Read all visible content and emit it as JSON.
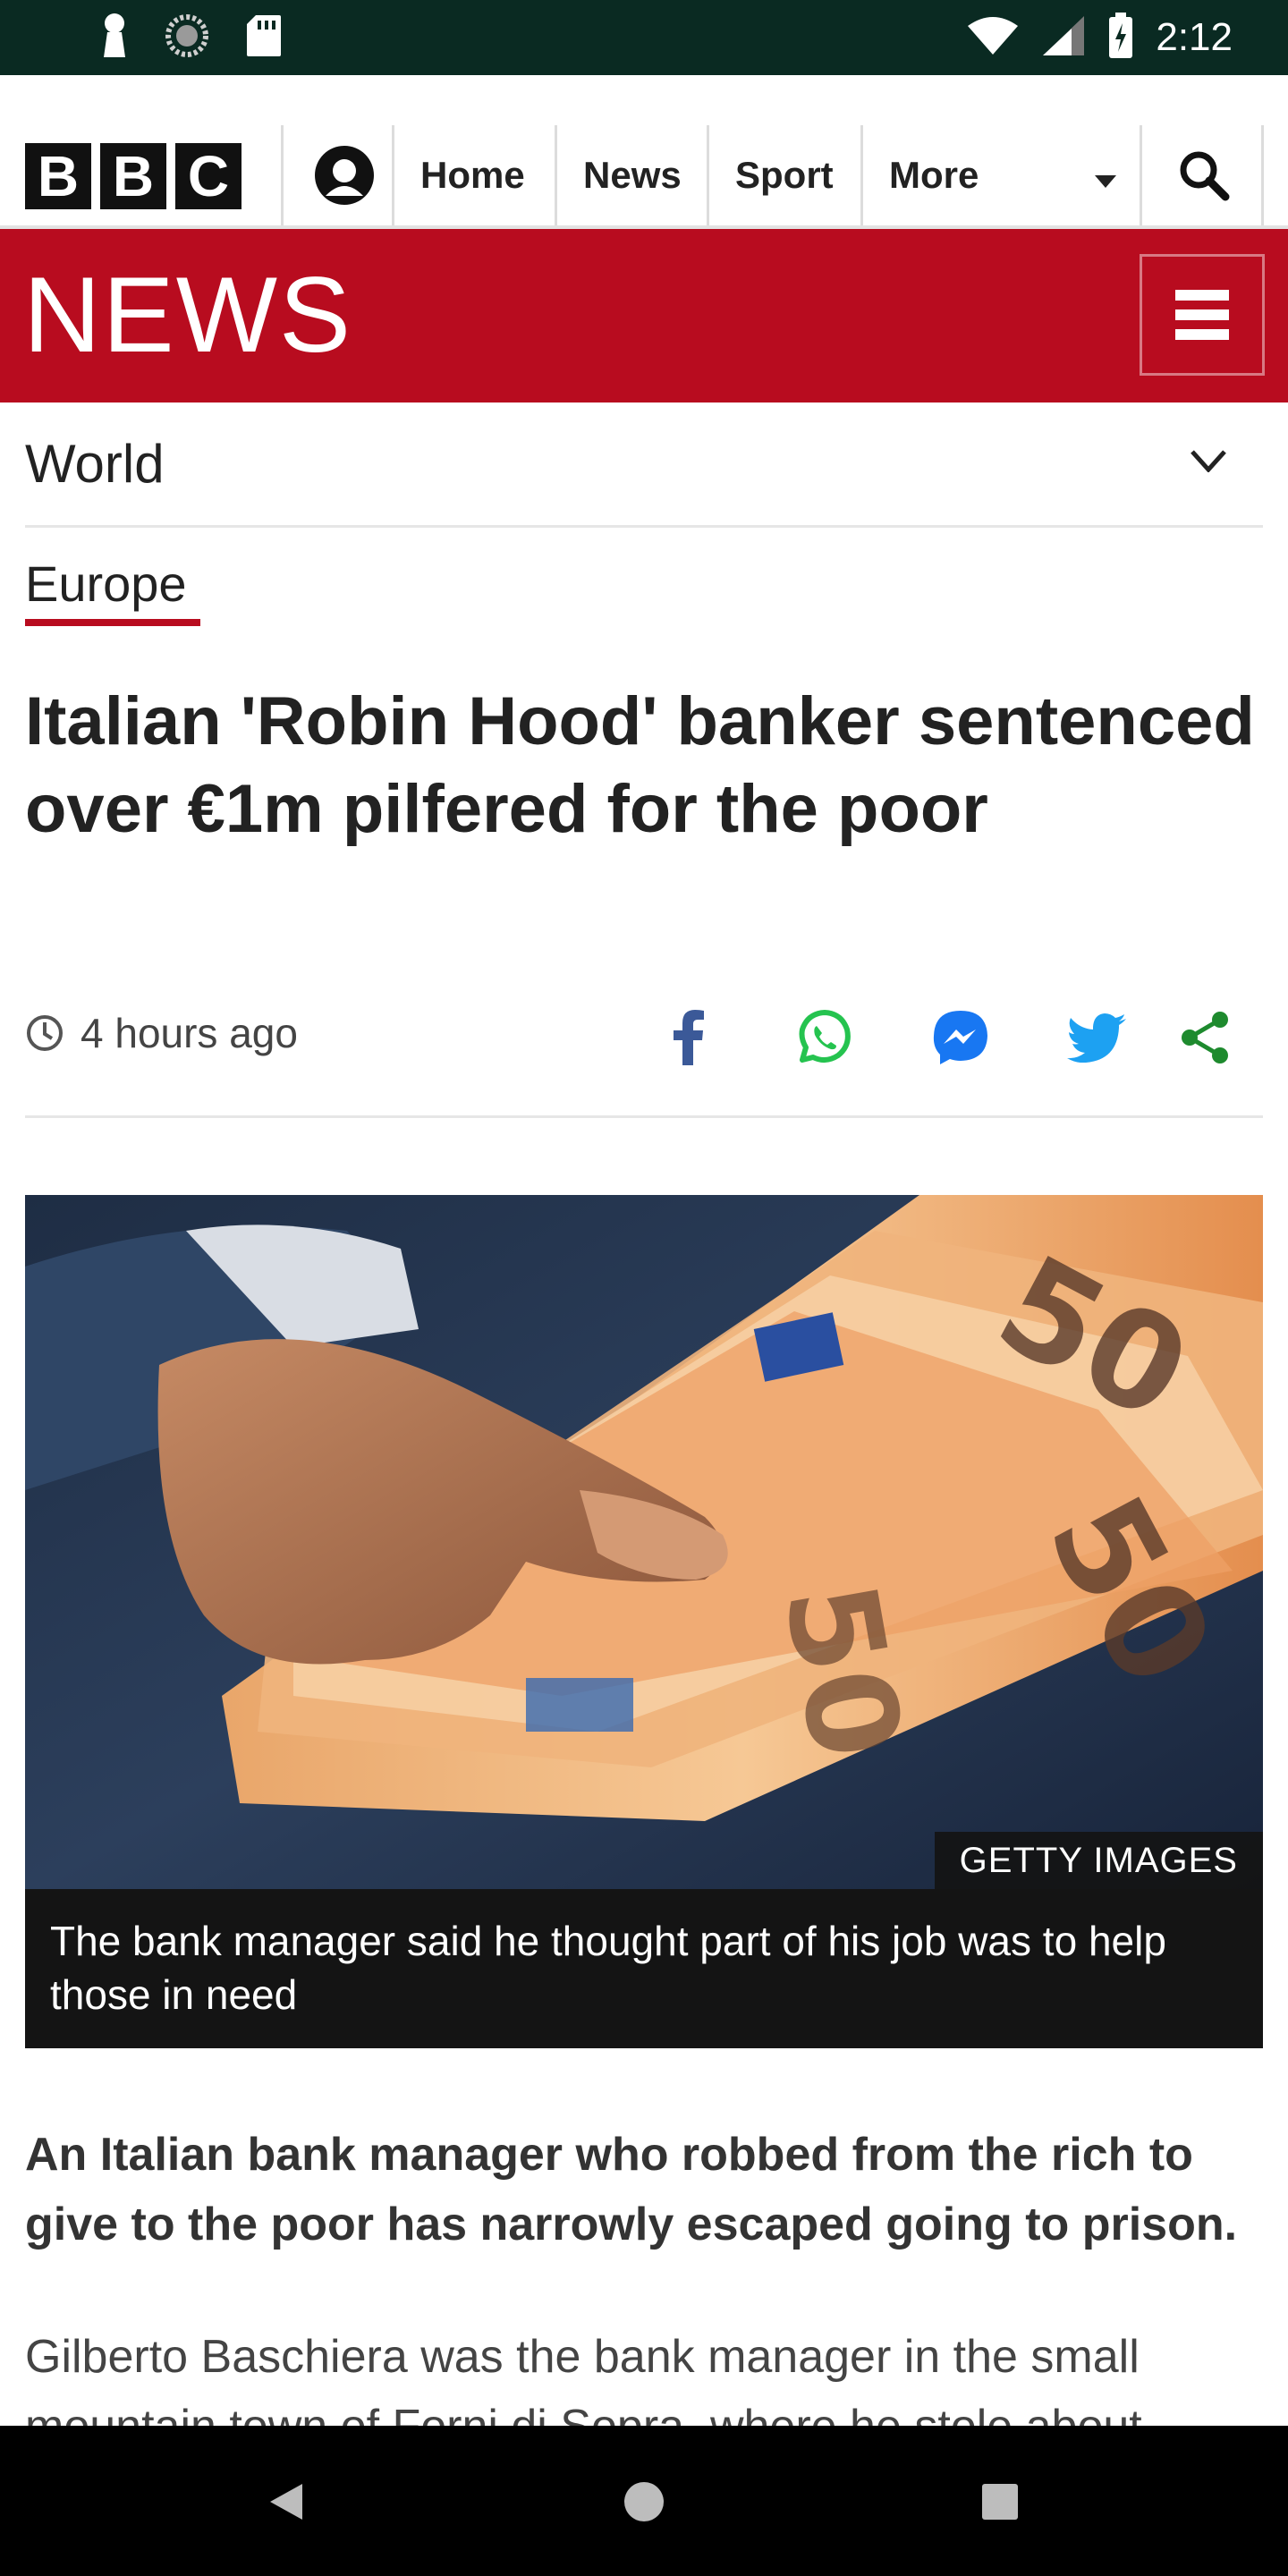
{
  "status_bar": {
    "time": "2:12",
    "icons": [
      "notification-icon",
      "sync-icon",
      "sd-card-icon",
      "wifi-icon",
      "cell-signal-icon",
      "battery-icon"
    ]
  },
  "bbc_nav": {
    "logo_letters": [
      "B",
      "B",
      "C"
    ],
    "links": [
      "Home",
      "News",
      "Sport",
      "More"
    ],
    "icons": [
      "account-icon",
      "caret-down-icon",
      "search-icon"
    ]
  },
  "news_banner": {
    "title": "NEWS",
    "menu_icon": "hamburger-icon",
    "color": "#b80c1f"
  },
  "world_nav": {
    "label": "World",
    "icon": "chevron-down-icon"
  },
  "article": {
    "section": "Europe",
    "headline": "Italian 'Robin Hood' banker sentenced over €1m pilfered for the poor",
    "timestamp": "4 hours ago",
    "share_icons": [
      "facebook-icon",
      "whatsapp-icon",
      "messenger-icon",
      "twitter-icon",
      "share-icon"
    ],
    "image": {
      "description_icon": "euro-banknotes-photo",
      "credit": "GETTY IMAGES",
      "caption": "The bank manager said he thought part of his job was to help those in need"
    },
    "lead": "An Italian bank manager who robbed from the rich to give to the poor has narrowly escaped going to prison.",
    "paragraph": "Gilberto Baschiera was the bank manager in the small mountain town of Forni di Sopra, where he stole about"
  },
  "android_nav": {
    "icons": [
      "back-icon",
      "home-icon",
      "recents-icon"
    ]
  }
}
